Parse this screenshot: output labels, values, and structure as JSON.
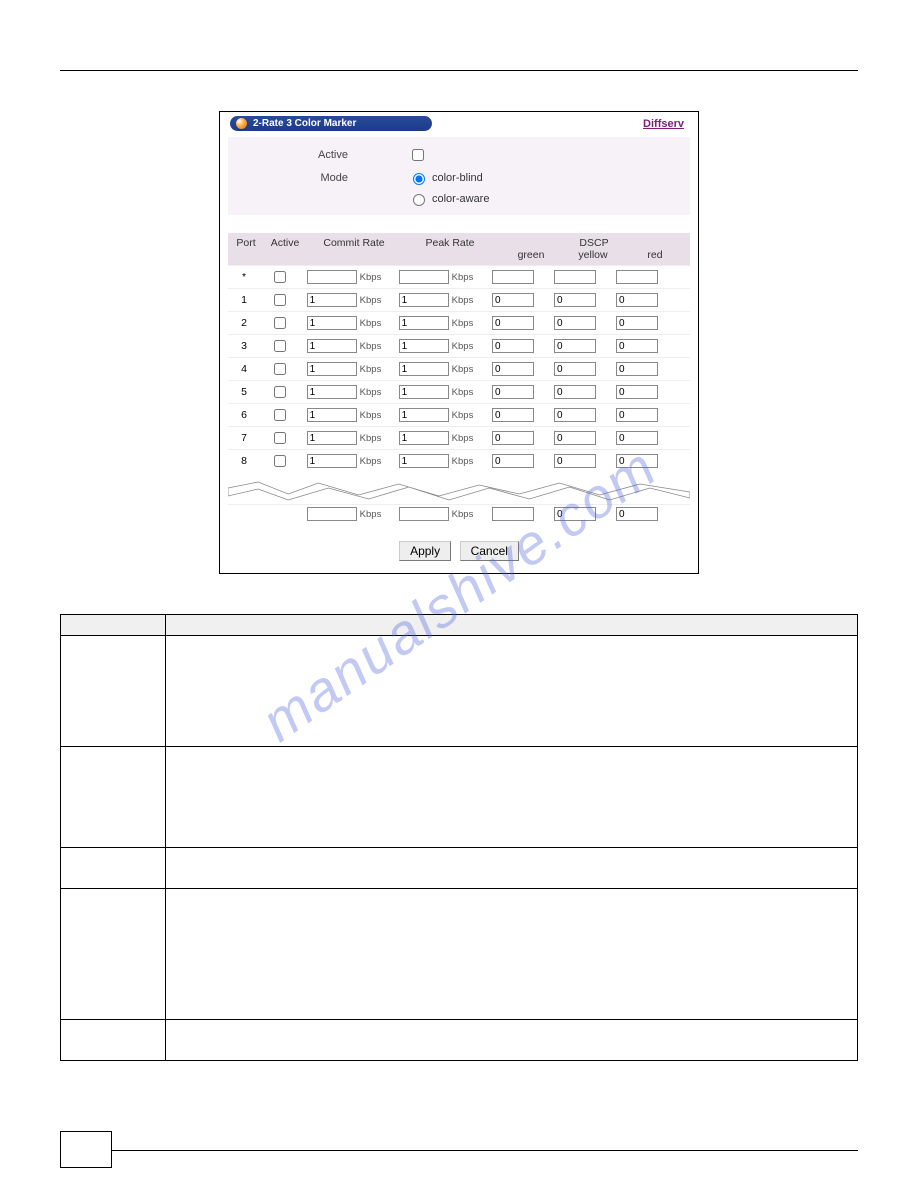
{
  "header": {
    "title": "2-Rate 3 Color Marker",
    "breadcrumb": "Diffserv"
  },
  "settings": {
    "activeLabel": "Active",
    "modeLabel": "Mode",
    "modeBlind": "color-blind",
    "modeAware": "color-aware"
  },
  "cols": {
    "port": "Port",
    "active": "Active",
    "commit": "Commit Rate",
    "peak": "Peak Rate",
    "dscp": "DSCP",
    "green": "green",
    "yellow": "yellow",
    "red": "red",
    "unit": "Kbps"
  },
  "rows": [
    {
      "port": "*",
      "commit": "",
      "peak": "",
      "g": "",
      "y": "",
      "r": ""
    },
    {
      "port": "1",
      "commit": "1",
      "peak": "1",
      "g": "0",
      "y": "0",
      "r": "0"
    },
    {
      "port": "2",
      "commit": "1",
      "peak": "1",
      "g": "0",
      "y": "0",
      "r": "0"
    },
    {
      "port": "3",
      "commit": "1",
      "peak": "1",
      "g": "0",
      "y": "0",
      "r": "0"
    },
    {
      "port": "4",
      "commit": "1",
      "peak": "1",
      "g": "0",
      "y": "0",
      "r": "0"
    },
    {
      "port": "5",
      "commit": "1",
      "peak": "1",
      "g": "0",
      "y": "0",
      "r": "0"
    },
    {
      "port": "6",
      "commit": "1",
      "peak": "1",
      "g": "0",
      "y": "0",
      "r": "0"
    },
    {
      "port": "7",
      "commit": "1",
      "peak": "1",
      "g": "0",
      "y": "0",
      "r": "0"
    },
    {
      "port": "8",
      "commit": "1",
      "peak": "1",
      "g": "0",
      "y": "0",
      "r": "0"
    }
  ],
  "lastrow": {
    "commit": "",
    "peak": "",
    "g": "",
    "y": "0",
    "r": "0"
  },
  "buttons": {
    "apply": "Apply",
    "cancel": "Cancel"
  },
  "desc": {
    "h1": "",
    "h2": "",
    "rows": [
      {
        "a": "",
        "b": ""
      },
      {
        "a": "",
        "b": ""
      },
      {
        "a": "",
        "b": ""
      },
      {
        "a": "",
        "b": ""
      },
      {
        "a": "",
        "b": ""
      }
    ]
  },
  "watermark": "manualshive.com"
}
